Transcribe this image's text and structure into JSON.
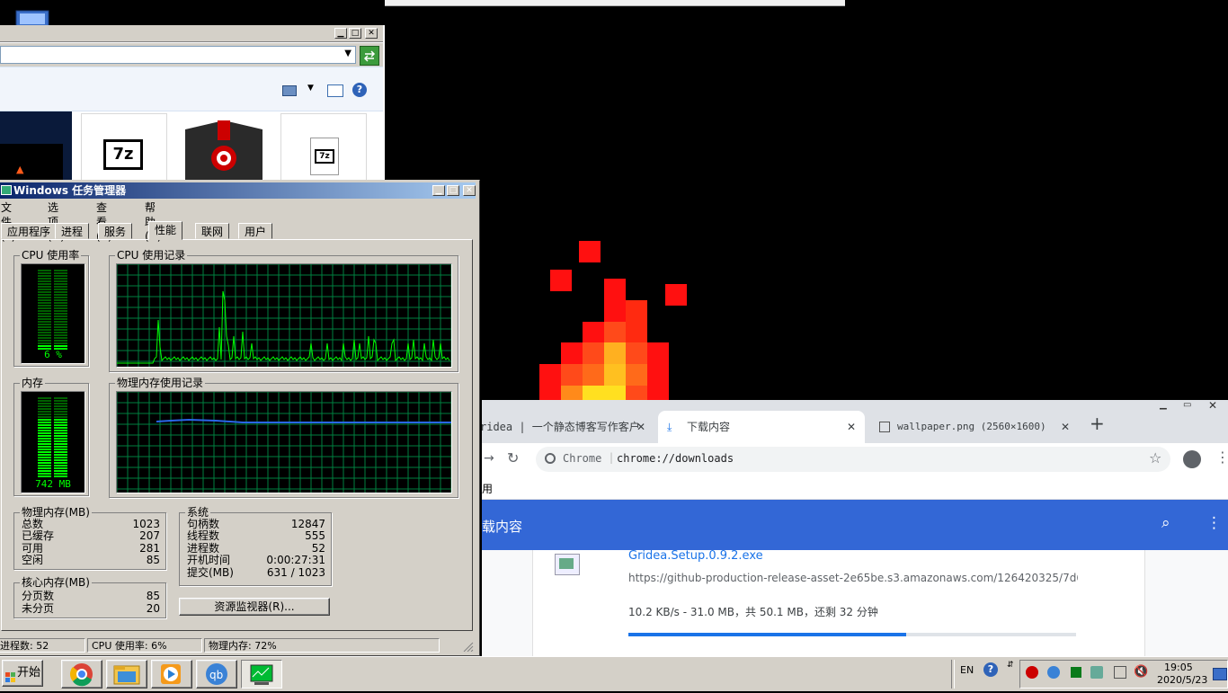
{
  "explorer": {
    "minimize_glyph": "▁",
    "maximize_glyph": "□",
    "close_glyph": "✕",
    "thumb_label_7z": "7z",
    "thumb_label_7z_file": "7z"
  },
  "taskmanager": {
    "title": "Windows 任务管理器",
    "menu": [
      "文件(F)",
      "选项(O)",
      "查看(V)",
      "帮助(H)"
    ],
    "tabs": [
      "应用程序",
      "进程",
      "服务",
      "性能",
      "联网",
      "用户"
    ],
    "active_tab": "性能",
    "cpu_usage_label": "CPU 使用率",
    "cpu_usage_value": "6 %",
    "cpu_usage_level": 0.06,
    "cpu_history_label": "CPU 使用记录",
    "memory_label": "内存",
    "memory_value": "742 MB",
    "memory_level": 0.72,
    "memory_history_label": "物理内存使用记录",
    "physical_memory": {
      "title": "物理内存(MB)",
      "rows": [
        {
          "label": "总数",
          "value": "1023"
        },
        {
          "label": "已缓存",
          "value": "207"
        },
        {
          "label": "可用",
          "value": "281"
        },
        {
          "label": "空闲",
          "value": "85"
        }
      ]
    },
    "kernel_memory": {
      "title": "核心内存(MB)",
      "rows": [
        {
          "label": "分页数",
          "value": "85"
        },
        {
          "label": "未分页",
          "value": "20"
        }
      ]
    },
    "system": {
      "title": "系统",
      "rows": [
        {
          "label": "句柄数",
          "value": "12847"
        },
        {
          "label": "线程数",
          "value": "555"
        },
        {
          "label": "进程数",
          "value": "52"
        },
        {
          "label": "开机时间",
          "value": "0:00:27:31"
        },
        {
          "label": "提交(MB)",
          "value": "631 / 1023"
        }
      ]
    },
    "resource_monitor_button": "资源监视器(R)...",
    "status": {
      "processes": "进程数: 52",
      "cpu": "CPU 使用率: 6%",
      "memory": "物理内存: 72%"
    },
    "colors": {
      "graph_green": "#00ff00",
      "grid": "#008040",
      "memory_line": "#2a66e8"
    }
  },
  "chrome": {
    "tabs": [
      {
        "title": "ridea | 一个静态博客写作客户"
      },
      {
        "title": "下载内容"
      },
      {
        "title": "wallpaper.png (2560×1600)"
      }
    ],
    "new_tab": "+",
    "omnibox_chip": "Chrome",
    "omnibox_url": "chrome://downloads",
    "bookmark_partial": "用",
    "page_title": "载内容",
    "download": {
      "filename": "Gridea.Setup.0.9.2.exe",
      "url": "https://github-production-release-asset-2e65be.s3.amazonaws.com/126420325/7d67...",
      "status": "10.2 KB/s - 31.0 MB，共 50.1 MB，还剩 32 分钟",
      "progress": 0.62
    },
    "colors": {
      "header": "#3367d6",
      "progress": "#1a73e8"
    }
  },
  "taskbar": {
    "start_label": "开始",
    "apps": [
      "chrome-icon",
      "explorer-icon",
      "media-player-icon",
      "qbittorrent-icon",
      "task-manager-icon"
    ],
    "language": "EN",
    "time": "19:05",
    "date": "2020/5/23"
  }
}
